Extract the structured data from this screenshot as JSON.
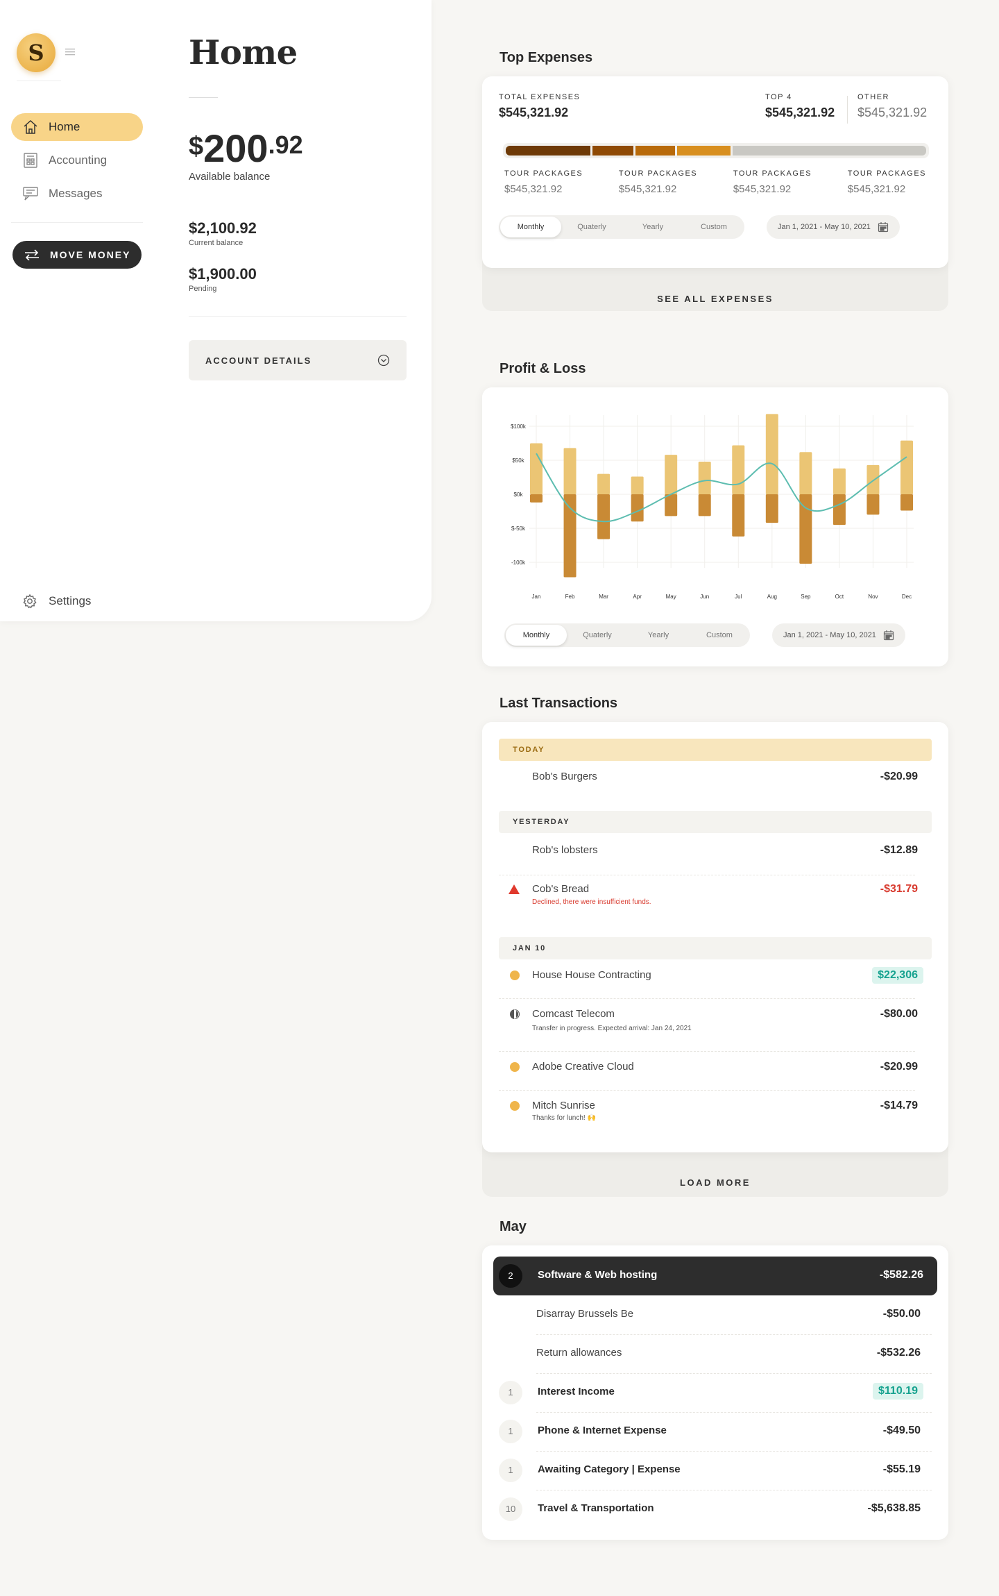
{
  "app": {
    "logo_letter": "S",
    "page_title": "Home"
  },
  "sidebar": {
    "items": [
      {
        "label": "Home",
        "icon": "home-icon",
        "active": true
      },
      {
        "label": "Accounting",
        "icon": "accounting-icon"
      },
      {
        "label": "Messages",
        "icon": "messages-icon"
      }
    ],
    "move_money": "MOVE MONEY",
    "settings": "Settings"
  },
  "balance": {
    "currency": "$",
    "integer": "200",
    "decimal": ".92",
    "available_label": "Available balance",
    "current_amount": "$2,100.92",
    "current_label": "Current balance",
    "pending_amount": "$1,900.00",
    "pending_label": "Pending",
    "account_details": "ACCOUNT DETAILS"
  },
  "top_expenses": {
    "title": "Top Expenses",
    "total_label": "TOTAL EXPENSES",
    "total_value": "$545,321.92",
    "top4_label": "TOP 4",
    "top4_value": "$545,321.92",
    "other_label": "OTHER",
    "other_value": "$545,321.92",
    "segments": [
      {
        "share": 0.205,
        "color": "#6e3a07"
      },
      {
        "share": 0.1,
        "color": "#8f4a05"
      },
      {
        "share": 0.095,
        "color": "#b86a0a"
      },
      {
        "share": 0.13,
        "color": "#d88f1f"
      },
      {
        "share": 0.47,
        "color": "#c9c8c3"
      }
    ],
    "categories": [
      {
        "label": "TOUR PACKAGES",
        "value": "$545,321.92"
      },
      {
        "label": "TOUR PACKAGES",
        "value": "$545,321.92"
      },
      {
        "label": "TOUR PACKAGES",
        "value": "$545,321.92"
      },
      {
        "label": "TOUR PACKAGES",
        "value": "$545,321.92"
      }
    ],
    "periods": [
      "Monthly",
      "Quaterly",
      "Yearly",
      "Custom"
    ],
    "date_range": "Jan 1, 2021 - May 10, 2021",
    "see_all": "SEE ALL EXPENSES"
  },
  "profit_loss": {
    "title": "Profit & Loss",
    "periods": [
      "Monthly",
      "Quaterly",
      "Yearly",
      "Custom"
    ],
    "date_range": "Jan 1, 2021 - May 10, 2021"
  },
  "chart_data": {
    "type": "bar",
    "categories": [
      "Jan",
      "Feb",
      "Mar",
      "Apr",
      "May",
      "Jun",
      "Jul",
      "Aug",
      "Sep",
      "Oct",
      "Nov",
      "Dec"
    ],
    "y_tick_labels": [
      "$100k",
      "$50k",
      "$0k",
      "$-50k",
      "-100k"
    ],
    "ylim": [
      -100,
      100
    ],
    "series": [
      {
        "values": [
          75,
          68,
          30,
          26,
          58,
          48,
          72,
          118,
          62,
          38,
          43,
          79
        ],
        "color": "#ebc574"
      },
      {
        "values": [
          -12,
          -122,
          -66,
          -40,
          -32,
          -32,
          -62,
          -42,
          -102,
          -45,
          -30,
          -24
        ],
        "color": "#c98a35"
      },
      {
        "values": [
          60,
          -20,
          -40,
          -25,
          0,
          20,
          15,
          45,
          -20,
          -15,
          20,
          55
        ],
        "color": "#5dbdb0"
      }
    ],
    "grid": true
  },
  "transactions": {
    "title": "Last Transactions",
    "groups": [
      {
        "day": "TODAY",
        "items": [
          {
            "name": "Bob's Burgers",
            "amount": "-$20.99"
          }
        ]
      },
      {
        "day": "YESTERDAY",
        "items": [
          {
            "name": "Rob's lobsters",
            "amount": "-$12.89"
          },
          {
            "name": "Cob's Bread",
            "amount": "-$31.79",
            "sub": "Declined, there were insufficient funds.",
            "status": "declined"
          }
        ]
      },
      {
        "day": "JAN 10",
        "items": [
          {
            "name": "House House Contracting",
            "amount": "$22,306",
            "status": "income"
          },
          {
            "name": "Comcast Telecom",
            "amount": "-$80.00",
            "sub": "Transfer in progress. Expected arrival: Jan 24, 2021",
            "status": "pending"
          },
          {
            "name": "Adobe Creative Cloud",
            "amount": "-$20.99"
          },
          {
            "name": "Mitch Sunrise",
            "amount": "-$14.79",
            "sub": "Thanks for lunch! 🙌"
          }
        ]
      }
    ],
    "load_more": "LOAD MORE"
  },
  "may": {
    "title": "May",
    "rows": [
      {
        "count": "2",
        "name": "Software & Web hosting",
        "amount": "-$582.26",
        "selected": true
      },
      {
        "name": "Disarray Brussels Be",
        "amount": "-$50.00",
        "sub": true
      },
      {
        "name": "Return allowances",
        "amount": "-$532.26",
        "sub": true
      },
      {
        "count": "1",
        "name": "Interest Income",
        "amount": "$110.19",
        "income": true
      },
      {
        "count": "1",
        "name": "Phone & Internet Expense",
        "amount": "-$49.50"
      },
      {
        "count": "1",
        "name": "Awaiting Category | Expense",
        "amount": "-$55.19"
      },
      {
        "count": "10",
        "name": "Travel & Transportation",
        "amount": "-$5,638.85"
      }
    ]
  }
}
